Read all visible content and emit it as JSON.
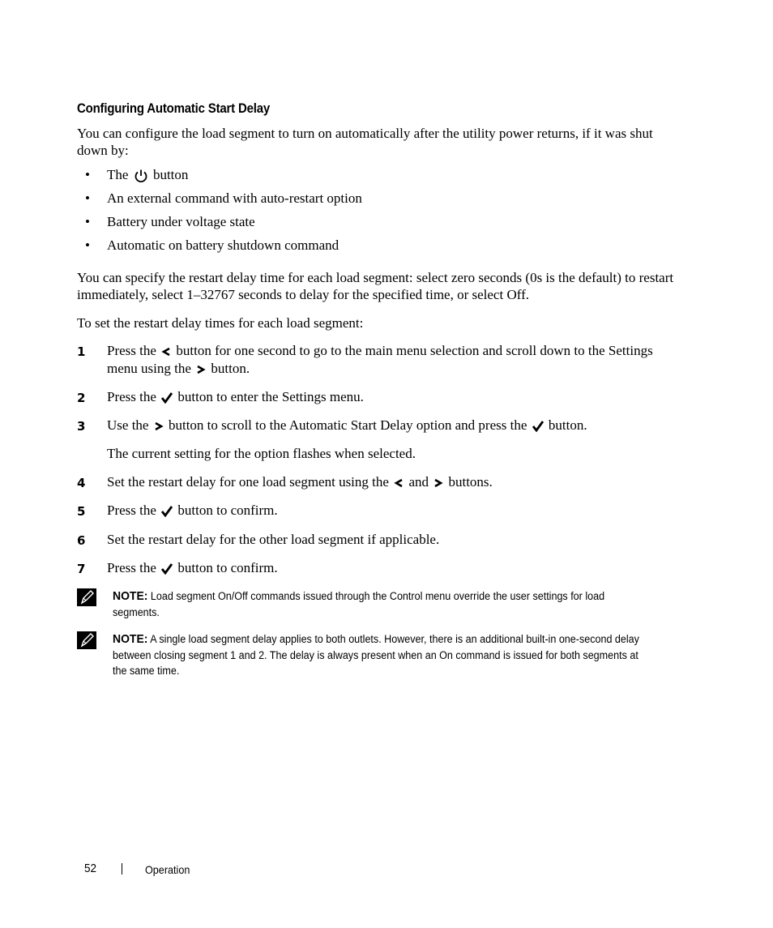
{
  "heading": "Configuring Automatic Start Delay",
  "intro": "You can configure the load segment to turn on automatically after the utility power returns, if it was shut down by:",
  "bullets": {
    "b0_pre": "The",
    "b0_post": "button",
    "b1": "An external command with auto-restart option",
    "b2": "Battery under voltage state",
    "b3": "Automatic on battery shutdown command"
  },
  "para2": "You can specify the restart delay time for each load segment: select zero seconds (0s is the default) to restart immediately, select 1–32767 seconds to delay for the specified time, or select Off.",
  "para3": "To set the restart delay times for each load segment:",
  "steps": {
    "s1": {
      "num": "1",
      "a": "Press the",
      "b": "button for one second to go to the main menu selection and scroll down to the Settings menu using the",
      "c": "button."
    },
    "s2": {
      "num": "2",
      "a": "Press the",
      "b": "button to enter the Settings menu."
    },
    "s3": {
      "num": "3",
      "a": "Use the",
      "b": "button to scroll to the Automatic Start Delay option and press the",
      "c": "button."
    },
    "s3_sub": "The current setting for the option flashes when selected.",
    "s4": {
      "num": "4",
      "a": "Set the restart delay for one load segment using the",
      "b": "and",
      "c": "buttons."
    },
    "s5": {
      "num": "5",
      "a": "Press the",
      "b": "button to confirm."
    },
    "s6": {
      "num": "6",
      "a": "Set the restart delay for the other load segment if applicable."
    },
    "s7": {
      "num": "7",
      "a": "Press the",
      "b": "button to confirm."
    }
  },
  "notes": [
    {
      "label": "NOTE:",
      "text": "Load segment On/Off commands issued through the Control menu override the user settings for load segments."
    },
    {
      "label": "NOTE:",
      "text": "A single load segment delay applies to both outlets. However, there is an additional built-in one-second delay between closing segment 1 and 2. The delay is always present when an On command is issued for both segments at the same time."
    }
  ],
  "footer": {
    "page_number": "52",
    "separator": "|",
    "section": "Operation"
  }
}
